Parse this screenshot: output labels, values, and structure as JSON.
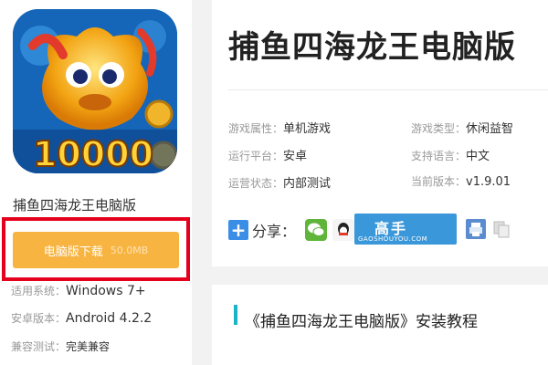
{
  "app": {
    "icon_text": "10000",
    "title": "捕鱼四海龙王电脑版",
    "download_label": "电脑版下载",
    "download_size": "50.0MB"
  },
  "left_meta": [
    {
      "key": "适用系统：",
      "value": "Windows 7+"
    },
    {
      "key": "安卓版本：",
      "value": "Android 4.2.2"
    },
    {
      "key": "兼容测试：",
      "value": "完美兼容"
    }
  ],
  "header": {
    "title": "捕鱼四海龙王电脑版"
  },
  "attributes": [
    {
      "key": "游戏属性：",
      "value": "单机游戏"
    },
    {
      "key": "游戏类型：",
      "value": "休闲益智"
    },
    {
      "key": "运行平台：",
      "value": "安卓"
    },
    {
      "key": "支持语言：",
      "value": "中文"
    },
    {
      "key": "运营状态：",
      "value": "内部测试"
    },
    {
      "key": "当前版本：",
      "value": "v1.9.01"
    }
  ],
  "share": {
    "label": "分享：",
    "plus": "+",
    "brand_logo_text": "高手",
    "site_text": "GAOSHOUYOU.COM"
  },
  "section": {
    "title": "《捕鱼四海龙王电脑版》安装教程"
  },
  "colors": {
    "download_button": "#f8b441",
    "highlight_border": "#e5001e",
    "accent_bar": "#1ab3c7",
    "share_plus": "#3a8ee6"
  }
}
